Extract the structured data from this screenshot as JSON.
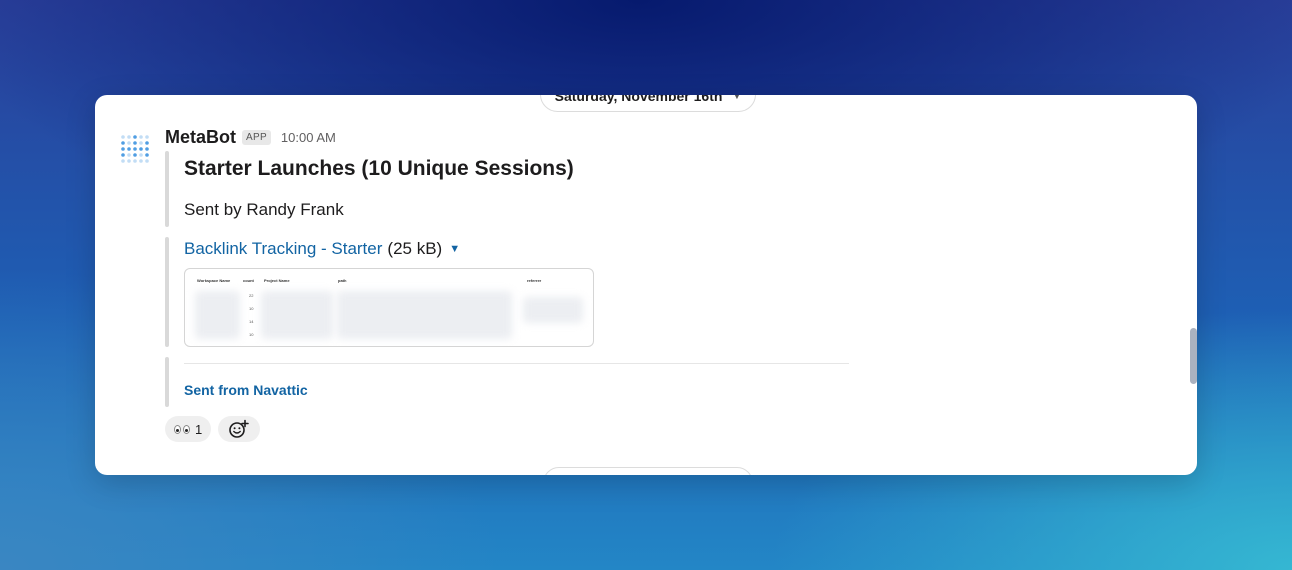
{
  "date_divider": {
    "label": "Saturday, November 16th"
  },
  "message": {
    "sender": "MetaBot",
    "badge": "APP",
    "time": "10:00 AM",
    "title": "Starter Launches (10 Unique Sessions)",
    "sent_by": "Sent by Randy Frank",
    "attachment": {
      "name": "Backlink Tracking - Starter",
      "size": "(25 kB)",
      "preview_columns": [
        "Workspace Name",
        "count",
        "Project Name",
        "path",
        "referrer"
      ],
      "preview_counts": [
        "22",
        "10",
        "14",
        "10"
      ]
    },
    "footer": "Sent from Navattic",
    "reactions": [
      {
        "emoji": "eyes",
        "count": "1"
      }
    ]
  },
  "icons": {
    "avatar": "metabase-dots-logo",
    "add_reaction": "add-reaction-icon",
    "date_chevron": "chevron-down-icon",
    "file_caret": "caret-down-icon"
  },
  "colors": {
    "link": "#1264a3",
    "logo": "#509ee3"
  }
}
